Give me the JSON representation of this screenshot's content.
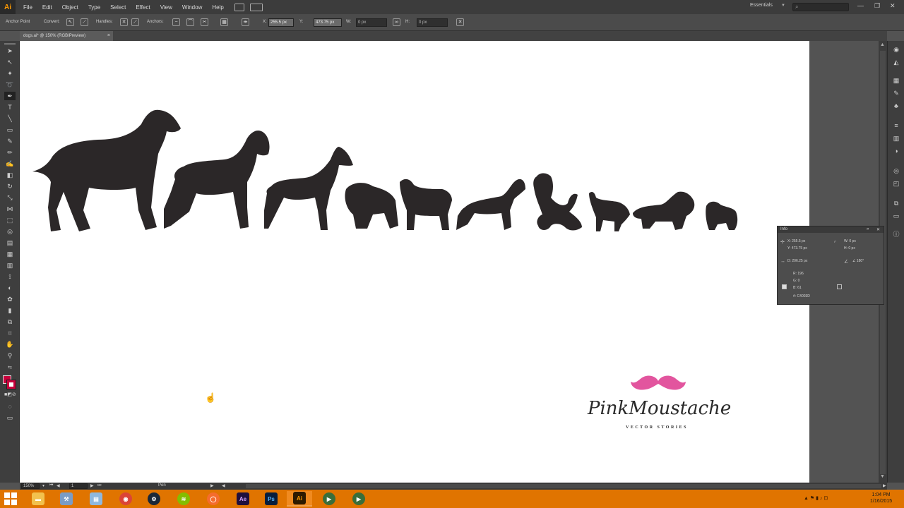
{
  "app": {
    "name": "Ai"
  },
  "menu": [
    "File",
    "Edit",
    "Object",
    "Type",
    "Select",
    "Effect",
    "View",
    "Window",
    "Help"
  ],
  "workspace": "Essentials",
  "control_bar": {
    "tool_name": "Anchor Point",
    "convert_label": "Convert:",
    "handles_label": "Handles:",
    "anchors_label": "Anchors:",
    "x_label": "X:",
    "x_value": "255.5 px",
    "y_label": "Y:",
    "y_value": "473.75 px",
    "w_label": "W:",
    "w_value": "0 px",
    "h_label": "H:",
    "h_value": "0 px"
  },
  "document_tab": {
    "label": "dogs.ai* @ 150% (RGB/Preview)",
    "close": "×"
  },
  "logo": {
    "main": "PinkMoustache",
    "sub": "VECTOR STORIES",
    "moustache_color": "#e2559e"
  },
  "triangle_color": "#c8003c",
  "silhouette_color": "#2b2728",
  "info_panel": {
    "title": "Info",
    "x": "X: 255.5 px",
    "y": "Y: 473.75 px",
    "w": "W: 0 px",
    "h": "H: 0 px",
    "d": "D: 206.25 px",
    "angle": "∠ 180°",
    "r": "R: 196",
    "g": "G: 0",
    "b": "B: 61",
    "hex": "#: C4003D"
  },
  "status_bar": {
    "zoom": "150%",
    "page": "1",
    "tool": "Pen"
  },
  "taskbar": {
    "time": "1:04 PM",
    "date": "1/16/2015",
    "apps": [
      "File Explorer",
      "Tools",
      "Notepad",
      "Chrome",
      "Steam",
      "Spotify",
      "Origin",
      "After Effects",
      "Photoshop",
      "Illustrator",
      "Media Player",
      "Media Player 2"
    ]
  },
  "colors": {
    "fill": "#c8003c",
    "stroke": "#c8003c",
    "accent": "#ff9a00",
    "taskbar": "#e07400"
  }
}
